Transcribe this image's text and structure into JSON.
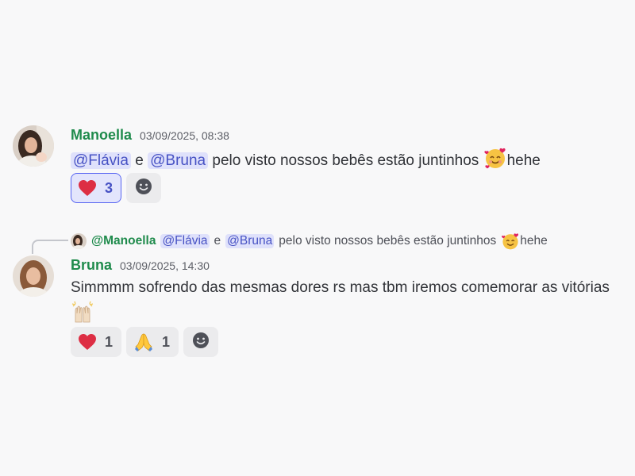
{
  "messages": [
    {
      "author": "Manoella",
      "author_color": "#1f8b4c",
      "timestamp": "03/09/2025, 08:38",
      "mention_1": "@Flávia",
      "connector": "e",
      "mention_2": "@Bruna",
      "text": "pelo visto nossos bebês estão juntinhos",
      "emoji": "smiling-face-with-hearts",
      "text_after": "hehe",
      "reactions": [
        {
          "emoji": "heart",
          "count": "3",
          "me": true
        }
      ]
    },
    {
      "reply": {
        "author": "@Manoella",
        "mention_1": "@Flávia",
        "connector": "e",
        "mention_2": "@Bruna",
        "text": "pelo visto nossos bebês estão juntinhos",
        "emoji": "smiling-face-with-hearts",
        "text_after": "hehe"
      },
      "author": "Bruna",
      "author_color": "#1f8b4c",
      "timestamp": "03/09/2025, 14:30",
      "text": "Simmmm sofrendo das mesmas dores rs mas tbm iremos comemorar as vitórias",
      "emoji": "raising-hands",
      "reactions": [
        {
          "emoji": "heart",
          "count": "1",
          "me": false
        },
        {
          "emoji": "folded-hands",
          "count": "1",
          "me": false
        }
      ]
    }
  ],
  "colors": {
    "mention_bg": "#dfe1fb",
    "mention_text": "#4752c4",
    "reaction_selected_border": "#5865f2"
  }
}
